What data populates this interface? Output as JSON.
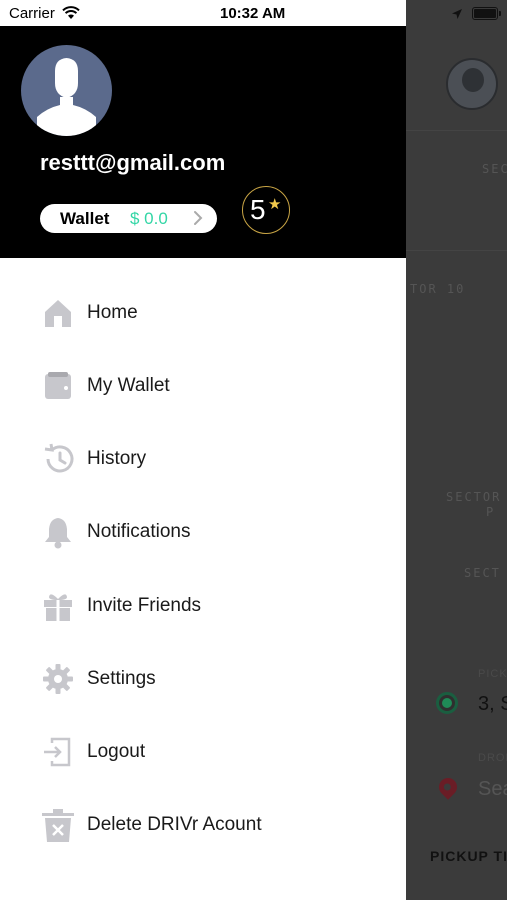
{
  "status_bar": {
    "carrier": "Carrier",
    "time": "10:32 AM"
  },
  "profile": {
    "email": "resttt@gmail.com",
    "wallet_label": "Wallet",
    "wallet_amount": "$ 0.0",
    "rating": "5"
  },
  "menu": [
    {
      "label": "Home",
      "icon": "home-icon"
    },
    {
      "label": "My Wallet",
      "icon": "wallet-icon"
    },
    {
      "label": "History",
      "icon": "history-icon"
    },
    {
      "label": "Notifications",
      "icon": "bell-icon"
    },
    {
      "label": "Invite Friends",
      "icon": "gift-icon"
    },
    {
      "label": "Settings",
      "icon": "gear-icon"
    },
    {
      "label": "Logout",
      "icon": "logout-icon"
    },
    {
      "label": "Delete DRIVr Acount",
      "icon": "trash-icon"
    }
  ],
  "background": {
    "sector_top": "SECT",
    "sector_mid": "TOR 10",
    "sector_lower": "SECTOR",
    "sector_lower2": "P",
    "sector_bottom": "SECT",
    "pickup_label": "PICK",
    "pickup_address": "3, S",
    "drop_label": "DROP",
    "search_placeholder": "Sea",
    "pickup_time": "PICKUP TI"
  },
  "colors": {
    "accent_green": "#33d6a6",
    "rating_star": "#f2c94c",
    "header_bg": "#000000"
  }
}
